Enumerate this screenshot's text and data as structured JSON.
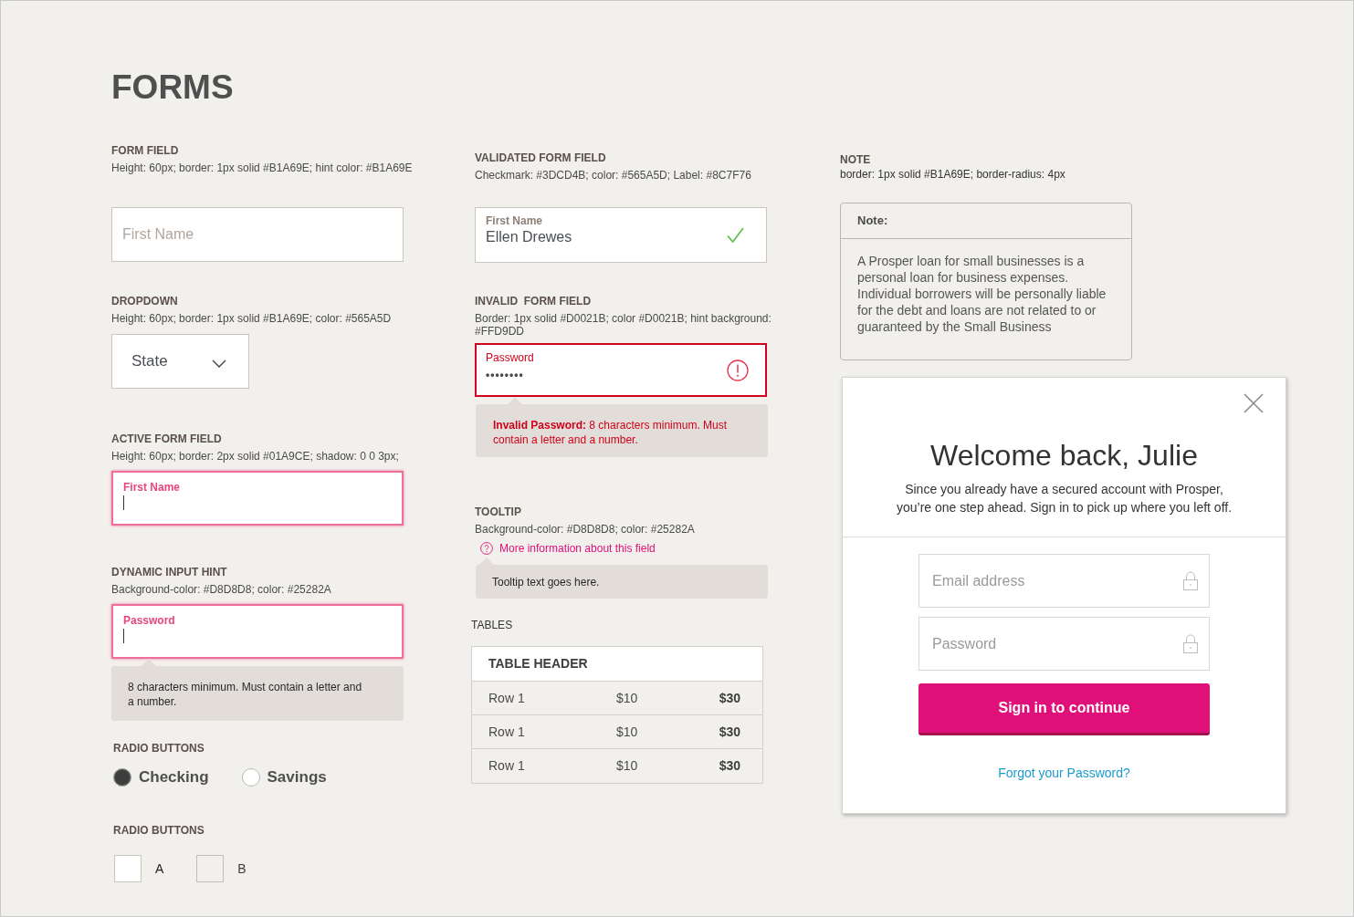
{
  "page_title": "FORMS",
  "form_field": {
    "heading": "FORM FIELD",
    "spec": "Height: 60px; border: 1px solid #B1A69E; hint color: #B1A69E",
    "placeholder": "First Name"
  },
  "dropdown": {
    "heading": "DROPDOWN",
    "spec": "Height: 60px; border: 1px solid #B1A69E; color: #565A5D",
    "value": "State"
  },
  "active_form_field": {
    "heading": "ACTIVE FORM FIELD",
    "spec": "Height: 60px; border: 2px solid #01A9CE; shadow: 0 0 3px;",
    "label": "First Name",
    "focused": true
  },
  "dynamic_input_hint": {
    "heading": "DYNAMIC INPUT HINT",
    "spec": "Background-color: #D8D8D8; color: #25282A",
    "label": "Password",
    "focused": true,
    "hint": "8 characters minimum. Must contain a letter and a number."
  },
  "radio_buttons": {
    "heading": "RADIO BUTTONS",
    "options": [
      {
        "label": "Checking",
        "selected": true
      },
      {
        "label": "Savings",
        "selected": false
      }
    ]
  },
  "square_radio_buttons": {
    "heading": "RADIO BUTTONS",
    "options": [
      {
        "label": "A",
        "selected": false,
        "disabled": false
      },
      {
        "label": "B",
        "selected": false,
        "disabled": true
      }
    ]
  },
  "validated_form_field": {
    "heading": "VALIDATED FORM FIELD",
    "spec": "Checkmark: #3DCD4B; color: #565A5D; Label: #8C7F76",
    "label": "First Name",
    "value": "Ellen Drewes",
    "valid": true,
    "invalid": false
  },
  "invalid_form_field": {
    "heading": "INVALID  FORM FIELD",
    "spec": "Border: 1px solid #D0021B; color #D0021B; hint background: #FFD9DD",
    "label": "Password",
    "value": "••••••••",
    "valid": false,
    "invalid": true,
    "hint": "**Invalid Password:** 8 characters minimum. Must contain a letter and a number."
  },
  "tooltip": {
    "heading": "TOOLTIP",
    "spec": "Background-color: #D8D8D8; color: #25282A",
    "link": "More information about this field",
    "text": "Tooltip text goes here."
  },
  "tables": {
    "heading": "TABLES",
    "header": "TABLE HEADER",
    "rows": [
      [
        "Row 1",
        "$10",
        "$30"
      ],
      [
        "Row 1",
        "$10",
        "$30"
      ],
      [
        "Row 1",
        "$10",
        "$30"
      ]
    ]
  },
  "note": {
    "heading": "NOTE",
    "spec": "border: 1px solid #B1A69E; border-radius: 4px",
    "title": "Note:",
    "body": "A Prosper loan for small businesses is a personal loan for business expenses. Individual borrowers will be personally liable for the debt and loans are not related to or guaranteed by the Small Business"
  },
  "sign_in_modal": {
    "title": "Welcome back, Julie",
    "message": "Since you already have a secured account with Prosper, you’re one step ahead. Sign in to pick up where you left off.",
    "fields": [
      {
        "placeholder": "Email address"
      },
      {
        "placeholder": "Password"
      }
    ],
    "button": "Sign in to continue",
    "link": "Forgot your Password?"
  }
}
